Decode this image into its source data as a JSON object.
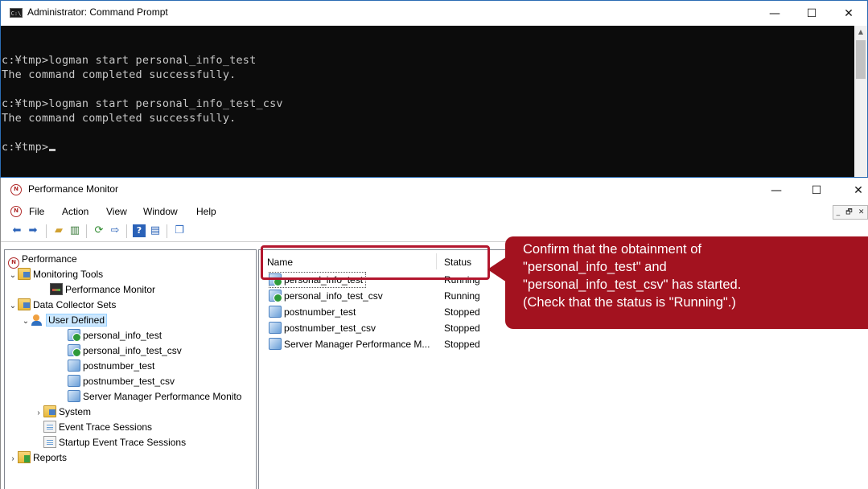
{
  "cmd": {
    "title": "Administrator: Command Prompt",
    "icon_label": "C:\\",
    "minimize": "—",
    "maximize": "☐",
    "close": "✕",
    "lines": [
      "c:¥tmp>logman start personal_info_test",
      "The command completed successfully.",
      "",
      "c:¥tmp>logman start personal_info_test_csv",
      "The command completed successfully.",
      ""
    ],
    "prompt": "c:¥tmp>",
    "scroll_up": "▲"
  },
  "perfmon": {
    "title": "Performance Monitor",
    "minimize": "—",
    "maximize": "☐",
    "close": "✕",
    "menu": [
      "File",
      "Action",
      "View",
      "Window",
      "Help"
    ],
    "mdi": {
      "minimize": "_",
      "restore": "🗗",
      "close": "✕"
    },
    "toolbar_icons": [
      "back-arrow-icon",
      "forward-arrow-icon",
      "up-folder-icon",
      "show-hide-tree-icon",
      "refresh-icon",
      "export-list-icon",
      "help-icon",
      "properties-icon",
      "new-window-icon"
    ],
    "tree": {
      "root": "Performance",
      "monitoring_tools": "Monitoring Tools",
      "performance_monitor": "Performance Monitor",
      "data_collector_sets": "Data Collector Sets",
      "user_defined": "User Defined",
      "user_defined_items": [
        "personal_info_test",
        "personal_info_test_csv",
        "postnumber_test",
        "postnumber_test_csv",
        "Server Manager Performance Monito"
      ],
      "system": "System",
      "event_trace_sessions": "Event Trace Sessions",
      "startup_event_trace_sessions": "Startup Event Trace Sessions",
      "reports": "Reports"
    },
    "list": {
      "columns": [
        "Name",
        "Status"
      ],
      "rows": [
        {
          "name": "personal_info_test",
          "status": "Running"
        },
        {
          "name": "personal_info_test_csv",
          "status": "Running"
        },
        {
          "name": "postnumber_test",
          "status": "Stopped"
        },
        {
          "name": "postnumber_test_csv",
          "status": "Stopped"
        },
        {
          "name": "Server Manager Performance M...",
          "status": "Stopped"
        }
      ]
    }
  },
  "callout": {
    "lines": [
      "Confirm that the obtainment of",
      "\"personal_info_test\" and",
      "\"personal_info_test_csv\" has started.",
      "(Check that the status is \"Running\".)"
    ],
    "color": "#a3121f"
  }
}
